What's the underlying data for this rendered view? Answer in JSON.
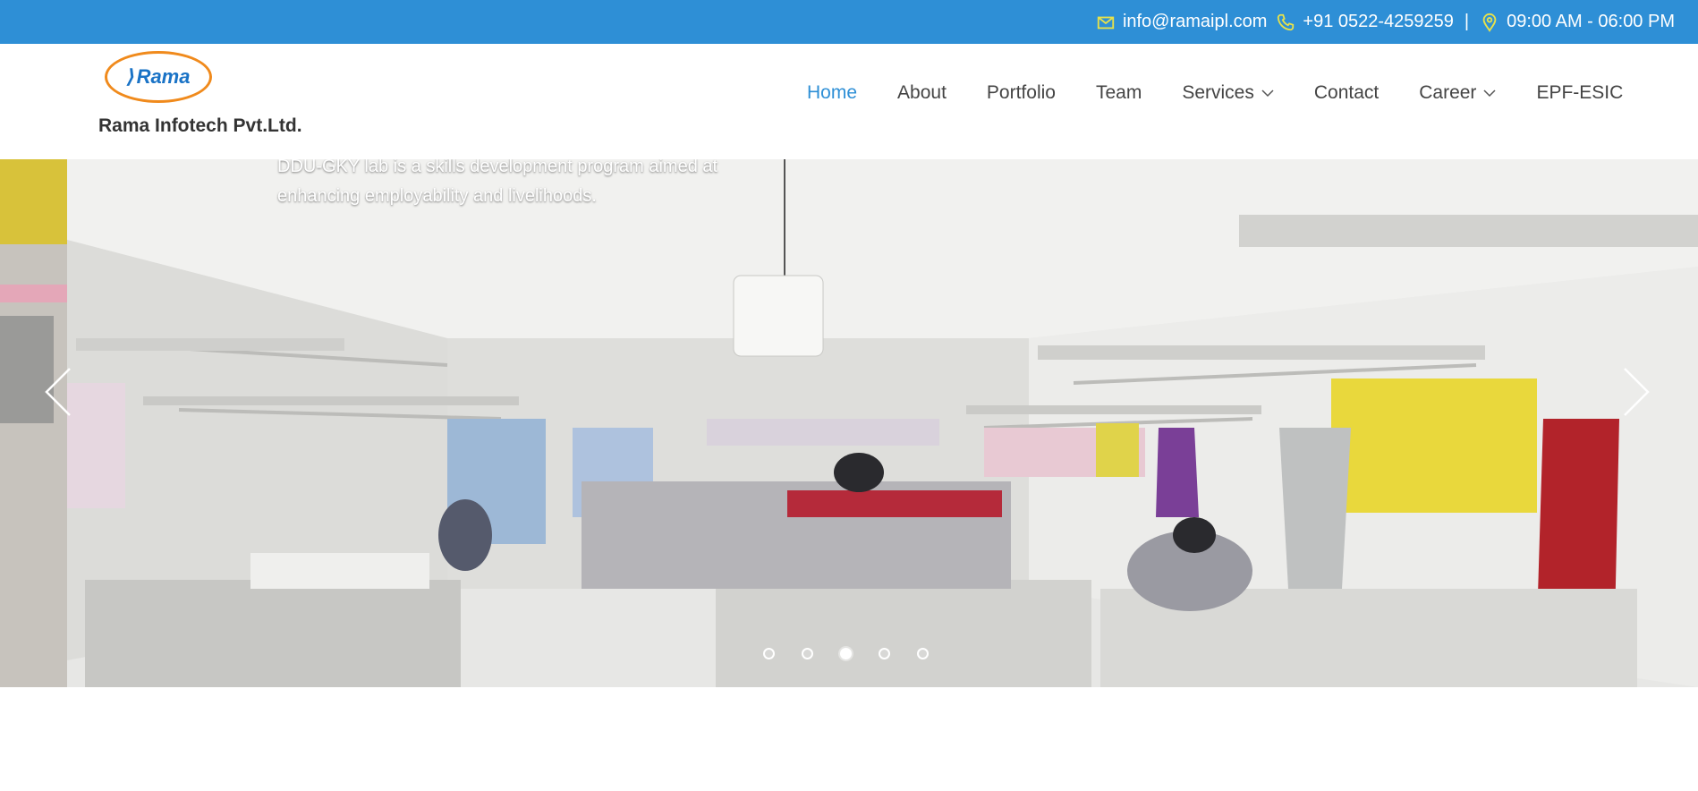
{
  "topbar": {
    "email": "info@ramaipl.com",
    "phone": "+91 0522-4259259",
    "separator": "|",
    "hours": "09:00 AM - 06:00 PM",
    "icons": {
      "email": "envelope-icon",
      "phone": "phone-icon",
      "location": "location-pin-icon"
    },
    "bg_color": "#2e8fd6",
    "icon_color": "#e8e24a"
  },
  "brand": {
    "logo_text": "Rama",
    "company_name": "Rama Infotech Pvt.Ltd.",
    "logo_border_color": "#f08a1c",
    "logo_text_color": "#1a73c6"
  },
  "nav": {
    "items": [
      {
        "label": "Home",
        "active": true
      },
      {
        "label": "About"
      },
      {
        "label": "Portfolio"
      },
      {
        "label": "Team"
      },
      {
        "label": "Services",
        "dropdown": true
      },
      {
        "label": "Contact"
      },
      {
        "label": "Career",
        "dropdown": true
      },
      {
        "label": "EPF-ESIC"
      }
    ],
    "active_color": "#2e8fd6"
  },
  "slider": {
    "caption_line1": "DDU-GKY lab is a skills development program aimed at",
    "caption_line2": "enhancing employability and livelihoods.",
    "slide_count": 5,
    "active_slide": 3,
    "icons": {
      "prev": "chevron-left-icon",
      "next": "chevron-right-icon"
    }
  }
}
